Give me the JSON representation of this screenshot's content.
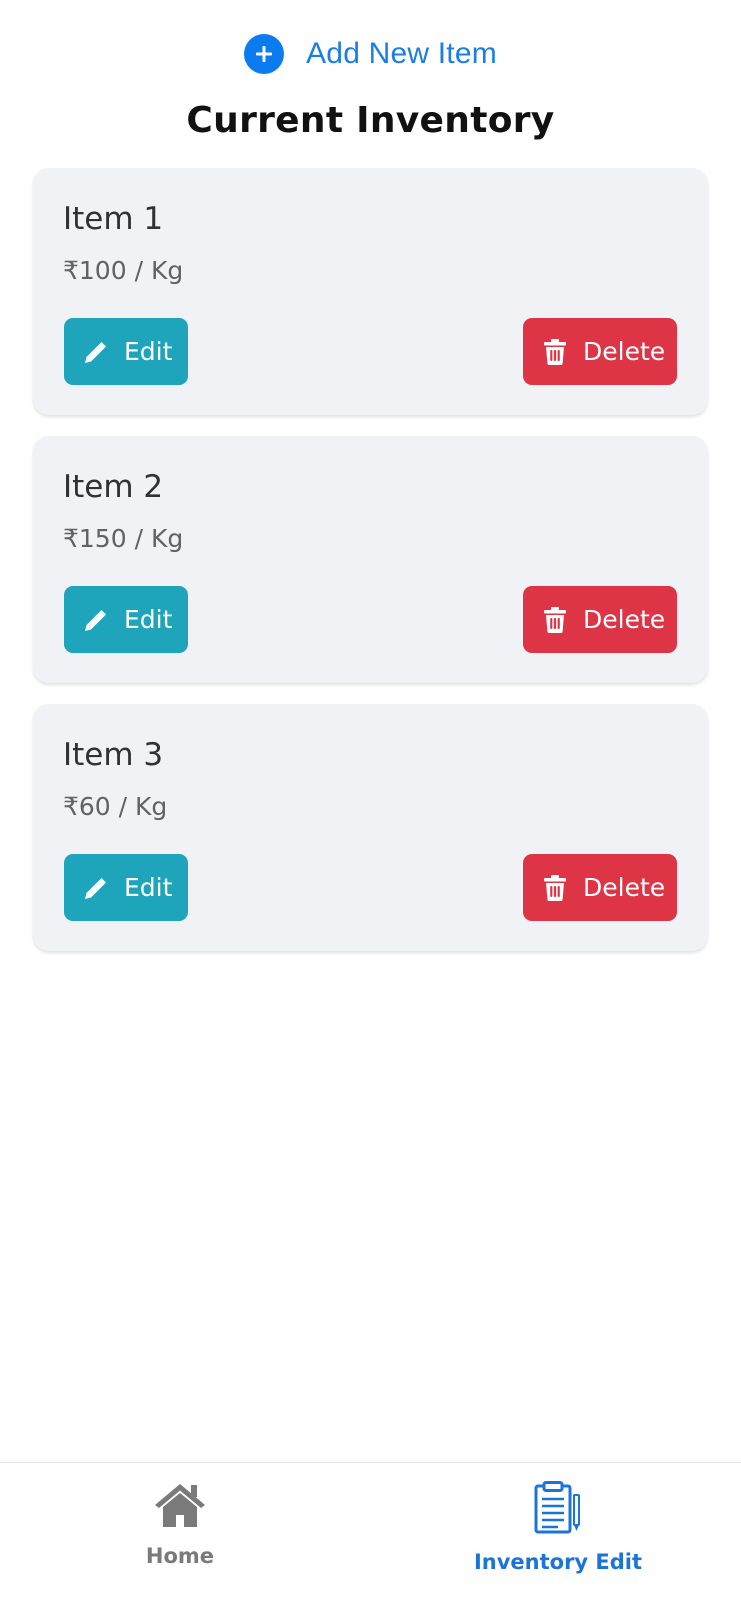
{
  "add_item": {
    "label": "Add New Item",
    "icon": "plus-circle-icon",
    "color": "#0a7cf0"
  },
  "page_title": "Current Inventory",
  "items": [
    {
      "name": "Item 1",
      "price": "₹100 / Kg",
      "edit_label": "Edit",
      "delete_label": "Delete"
    },
    {
      "name": "Item 2",
      "price": "₹150 / Kg",
      "edit_label": "Edit",
      "delete_label": "Delete"
    },
    {
      "name": "Item 3",
      "price": "₹60 / Kg",
      "edit_label": "Edit",
      "delete_label": "Delete"
    }
  ],
  "colors": {
    "edit_button": "#1ea5bc",
    "delete_button": "#de3546",
    "card_background": "#f0f2f5",
    "active_nav": "#1b74d8",
    "inactive_nav": "#7a7a7a"
  },
  "bottom_nav": {
    "items": [
      {
        "label": "Home",
        "icon": "home-icon",
        "active": false
      },
      {
        "label": "Inventory Edit",
        "icon": "clipboard-icon",
        "active": true
      }
    ]
  }
}
